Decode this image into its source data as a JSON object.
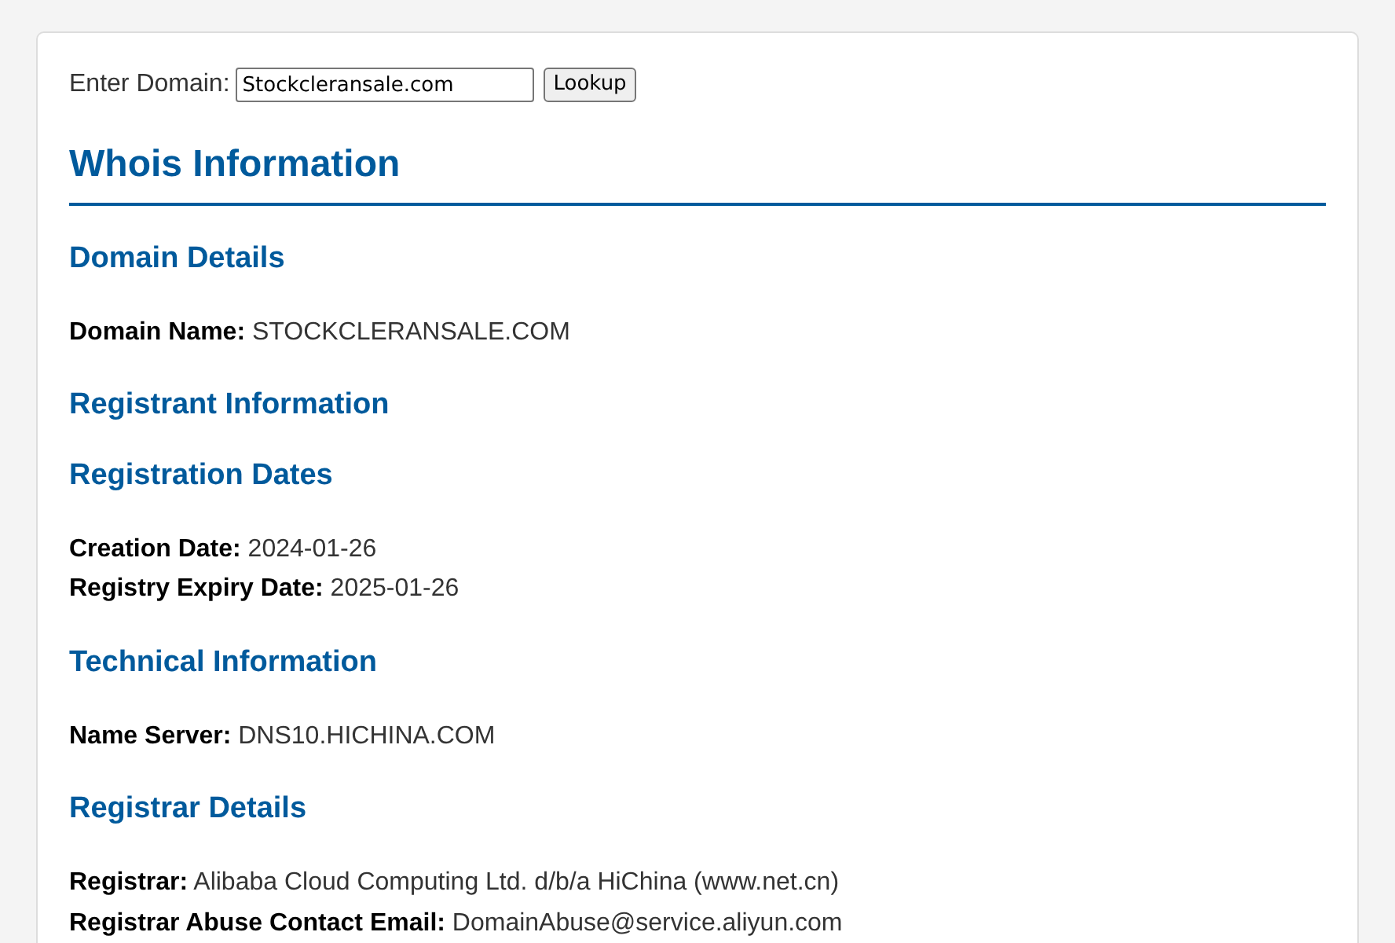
{
  "lookup": {
    "label": "Enter Domain:",
    "value": "Stockcleransale.com",
    "button": "Lookup"
  },
  "title": "Whois Information",
  "sections": [
    {
      "heading": "Domain Details",
      "fields": [
        {
          "label": "Domain Name:",
          "value": "STOCKCLERANSALE.COM"
        }
      ]
    },
    {
      "heading": "Registrant Information"
    },
    {
      "heading": "Registration Dates",
      "fields": [
        {
          "label": "Creation Date:",
          "value": "2024-01-26"
        },
        {
          "label": "Registry Expiry Date:",
          "value": "2025-01-26"
        }
      ]
    },
    {
      "heading": "Technical Information",
      "fields": [
        {
          "label": "Name Server:",
          "value": "DNS10.HICHINA.COM"
        }
      ]
    },
    {
      "heading": "Registrar Details",
      "fields": [
        {
          "label": "Registrar:",
          "value": "Alibaba Cloud Computing Ltd. d/b/a HiChina (www.net.cn)"
        },
        {
          "label": "Registrar Abuse Contact Email:",
          "value": "DomainAbuse@service.aliyun.com"
        }
      ]
    }
  ]
}
